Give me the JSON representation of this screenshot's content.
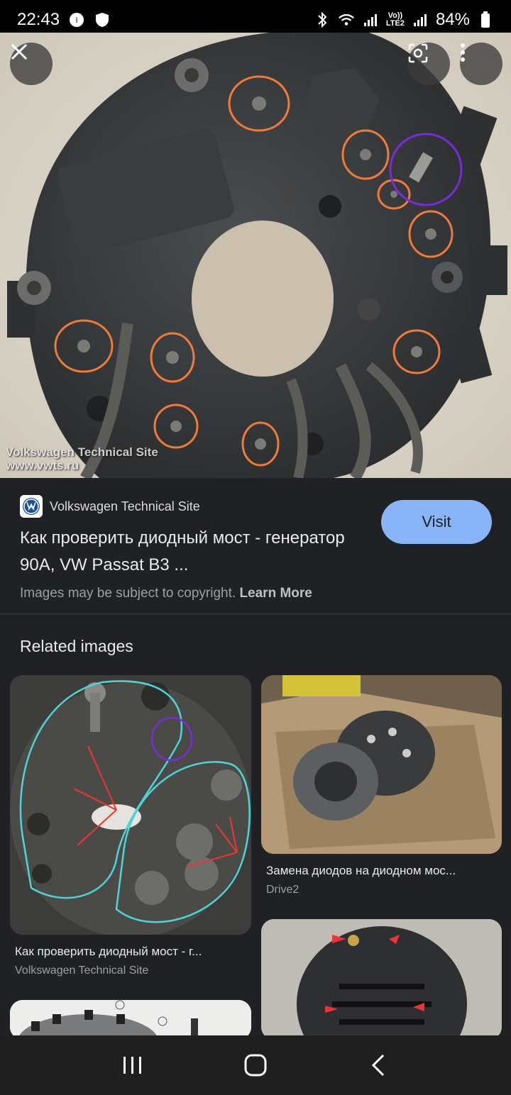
{
  "status_bar": {
    "time": "22:43",
    "battery": "84%",
    "network": "LTE2",
    "network_vo": "Vo))"
  },
  "hero": {
    "watermark_line1": "Volkswagen Technical Site",
    "watermark_line2": "www.vwts.ru",
    "close_icon": "close-icon",
    "lens_icon": "google-lens-icon",
    "more_icon": "more-vert-icon"
  },
  "info": {
    "source_name": "Volkswagen Technical Site",
    "title": "Как проверить диодный мост - генератор 90A, VW Passat B3 ...",
    "visit_label": "Visit",
    "copyright_text": "Images may be subject to copyright.",
    "learn_more": "Learn More"
  },
  "related": {
    "header": "Related images",
    "items": [
      {
        "title": "Как проверить диодный мост - г...",
        "source": "Volkswagen Technical Site"
      },
      {
        "title": "Замена диодов на диодном мос...",
        "source": "Drive2"
      },
      {
        "title": "",
        "source": ""
      },
      {
        "title": "",
        "source": ""
      }
    ]
  },
  "navbar": {
    "recent_icon": "recent-apps-icon",
    "home_icon": "home-icon",
    "back_icon": "back-icon"
  },
  "colors": {
    "background": "#202124",
    "accent": "#8ab4f8",
    "annotation_orange": "#f07a3a",
    "annotation_purple": "#7a2bd8"
  }
}
